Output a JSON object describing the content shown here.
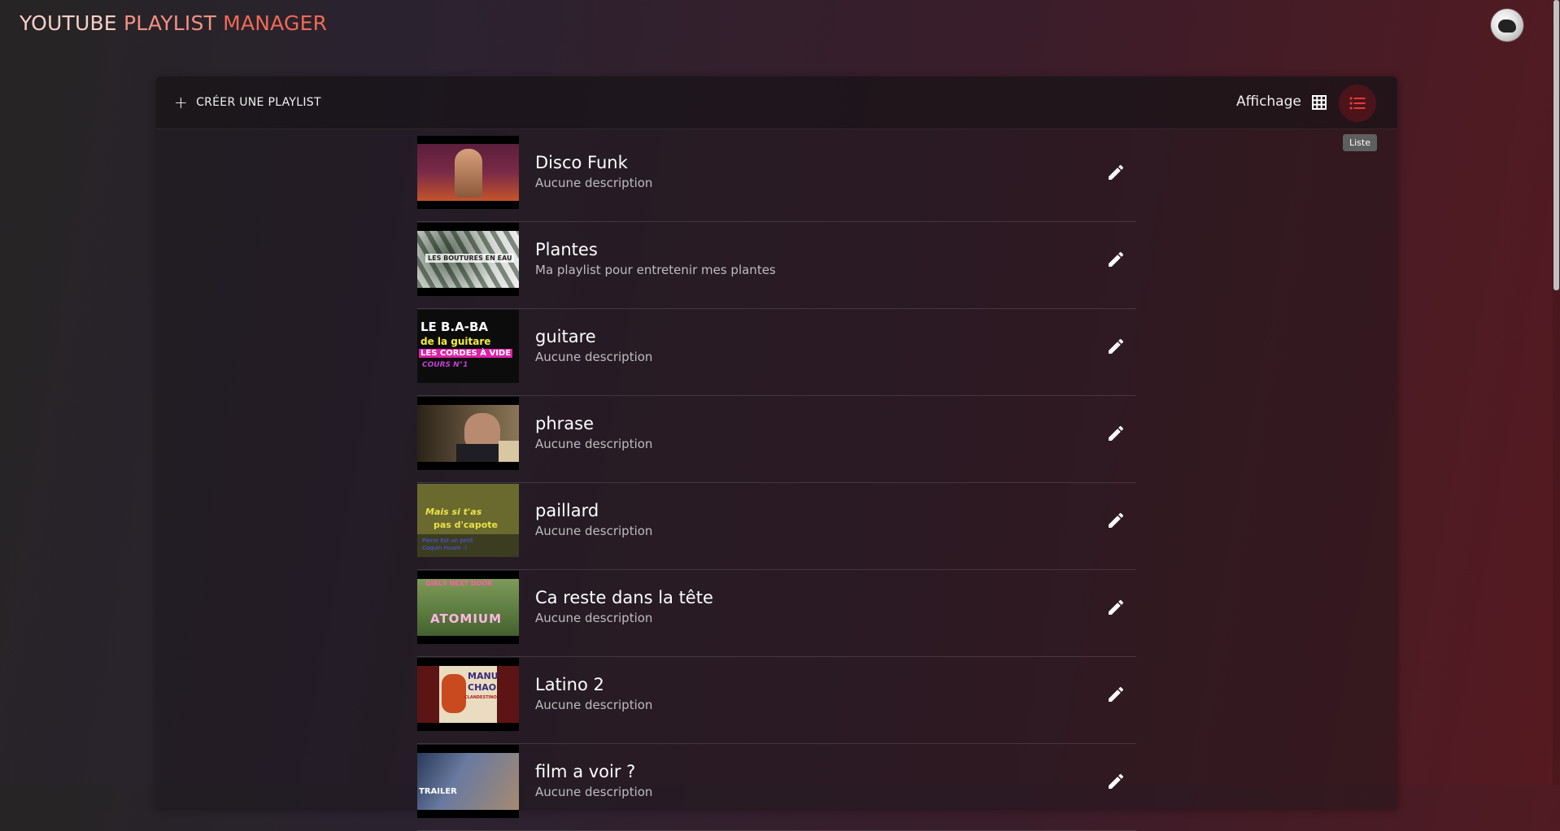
{
  "app": {
    "title_w1": "YOUTUBE",
    "title_w2": "PLAYLIST",
    "title_w3": "MANAGER"
  },
  "toolbar": {
    "create_label": "CRÉER UNE PLAYLIST",
    "view_label": "Affichage",
    "tooltip": "Liste"
  },
  "playlists": [
    {
      "title": "Disco Funk",
      "description": "Aucune description"
    },
    {
      "title": "Plantes",
      "description": "Ma playlist pour entretenir mes plantes"
    },
    {
      "title": "guitare",
      "description": "Aucune description"
    },
    {
      "title": "phrase",
      "description": "Aucune description"
    },
    {
      "title": "paillard",
      "description": "Aucune description"
    },
    {
      "title": "Ca reste dans la tête",
      "description": "Aucune description"
    },
    {
      "title": "Latino 2",
      "description": "Aucune description"
    },
    {
      "title": "film a voir ?",
      "description": "Aucune description"
    }
  ],
  "thumb_text": {
    "plantes": "LES BOUTURES EN EAU",
    "guitare_1": "LE B.A-BA",
    "guitare_2": "de la guitare",
    "guitare_3": "LES CORDES À VIDE",
    "guitare_4": "COURS N°1",
    "paillard_1": "Mais si t'as",
    "paillard_2": "pas d'capote",
    "paillard_3": "Pierre Est un petit",
    "paillard_4": "Coquin Huum :)",
    "ca_reste_1": "GIRLS NEXT DOOR",
    "ca_reste_2": "ATOMIUM",
    "latino_1": "MANU",
    "latino_2": "CHAO",
    "latino_3": "CLANDESTINO",
    "film": "TRAILER"
  },
  "colors": {
    "accent": "#e53935",
    "list_button_bg": "#6e141c"
  },
  "icons": {
    "create": "plus-icon",
    "grid_view": "grid-icon",
    "list_view": "list-icon",
    "edit": "pencil-icon"
  }
}
